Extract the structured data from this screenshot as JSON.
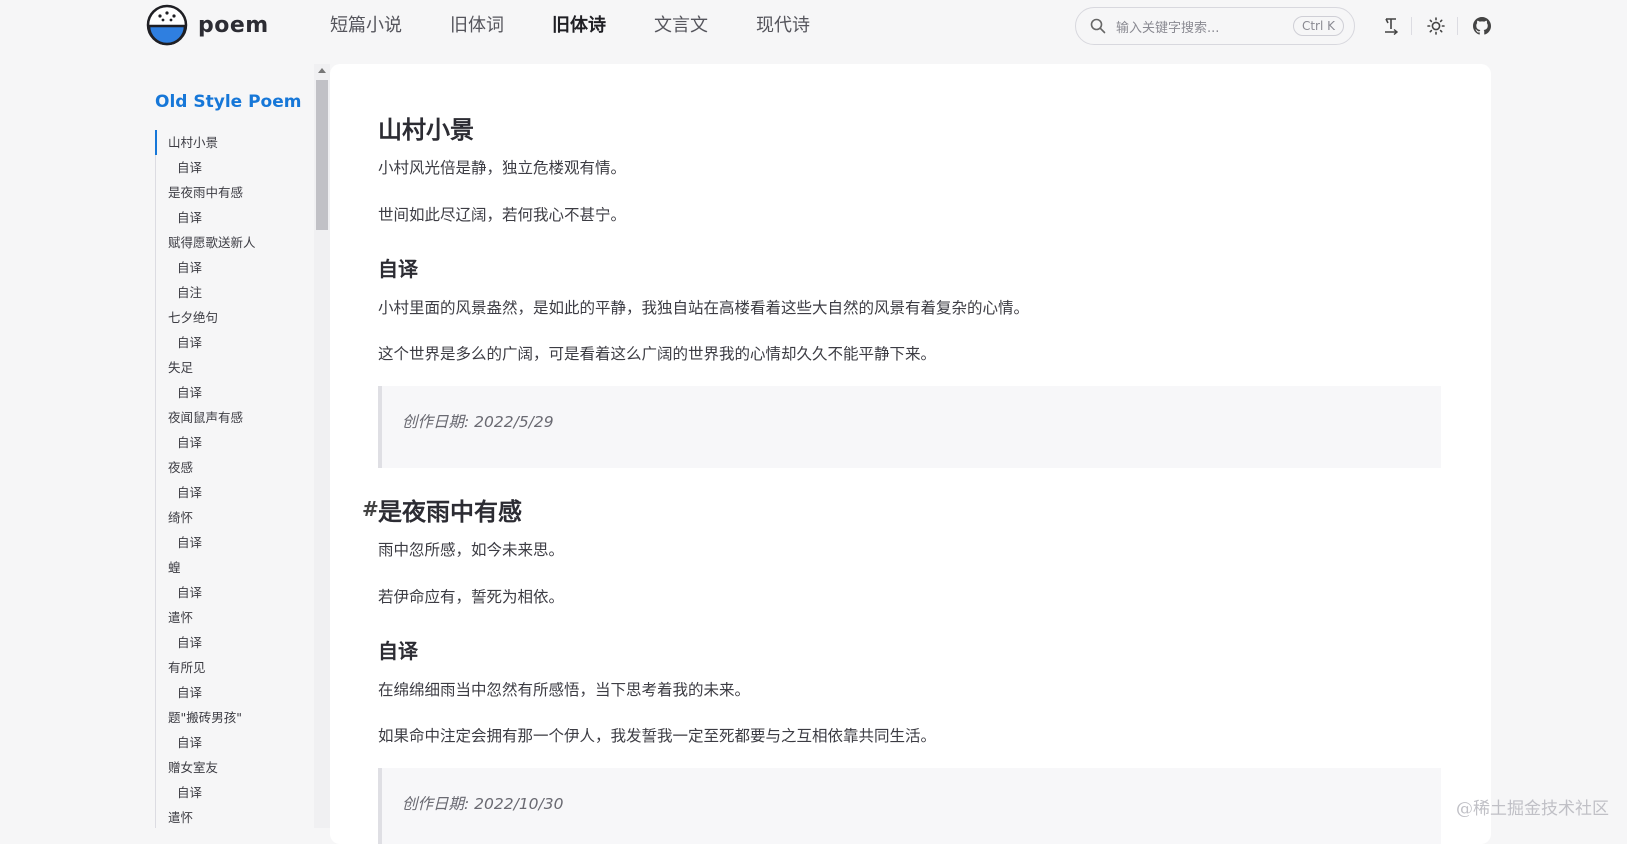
{
  "header": {
    "logo_text": "poem",
    "nav": [
      {
        "label": "短篇小说"
      },
      {
        "label": "旧体词"
      },
      {
        "label": "旧体诗",
        "active": true
      },
      {
        "label": "文言文"
      },
      {
        "label": "现代诗"
      }
    ],
    "search": {
      "placeholder": "输入关键字搜索...",
      "shortcut": "Ctrl K"
    },
    "icons": [
      "text-direction-icon",
      "sun-icon",
      "github-icon"
    ]
  },
  "sidebar": {
    "title": "Old Style Poem",
    "items": [
      {
        "label": "山村小景",
        "level": 1,
        "current": true
      },
      {
        "label": "自译",
        "level": 2
      },
      {
        "label": "是夜雨中有感",
        "level": 1
      },
      {
        "label": "自译",
        "level": 2
      },
      {
        "label": "赋得愿歌送新人",
        "level": 1
      },
      {
        "label": "自译",
        "level": 2
      },
      {
        "label": "自注",
        "level": 2
      },
      {
        "label": "七夕绝句",
        "level": 1
      },
      {
        "label": "自译",
        "level": 2
      },
      {
        "label": "失足",
        "level": 1
      },
      {
        "label": "自译",
        "level": 2
      },
      {
        "label": "夜闻鼠声有感",
        "level": 1
      },
      {
        "label": "自译",
        "level": 2
      },
      {
        "label": "夜感",
        "level": 1
      },
      {
        "label": "自译",
        "level": 2
      },
      {
        "label": "绮怀",
        "level": 1
      },
      {
        "label": "自译",
        "level": 2
      },
      {
        "label": "蝗",
        "level": 1
      },
      {
        "label": "自译",
        "level": 2
      },
      {
        "label": "遣怀",
        "level": 1
      },
      {
        "label": "自译",
        "level": 2
      },
      {
        "label": "有所见",
        "level": 1
      },
      {
        "label": "自译",
        "level": 2
      },
      {
        "label": "题\"搬砖男孩\"",
        "level": 1
      },
      {
        "label": "自译",
        "level": 2
      },
      {
        "label": "赠女室友",
        "level": 1
      },
      {
        "label": "自译",
        "level": 2
      },
      {
        "label": "遣怀",
        "level": 1
      }
    ]
  },
  "article": {
    "sections": [
      {
        "title": "山村小景",
        "lines": [
          "小村风光倍是静，独立危楼观有情。",
          "世间如此尽辽阔，若何我心不甚宁。"
        ],
        "sub_title": "自译",
        "translation": [
          "小村里面的风景盎然，是如此的平静，我独自站在高楼看着这些大自然的风景有着复杂的心情。",
          "这个世界是多么的广阔，可是看着这么广阔的世界我的心情却久久不能平静下来。"
        ],
        "date": "创作日期: 2022/5/29"
      },
      {
        "anchor": "#",
        "title": "是夜雨中有感",
        "lines": [
          "雨中忽所感，如今未来思。",
          "若伊命应有，誓死为相依。"
        ],
        "sub_title": "自译",
        "translation": [
          "在绵绵细雨当中忽然有所感悟，当下思考着我的未来。",
          "如果命中注定会拥有那一个伊人，我发誓我一定至死都要与之互相依靠共同生活。"
        ],
        "date": "创作日期: 2022/10/30"
      }
    ]
  },
  "watermark": "@稀土掘金技术社区",
  "colors": {
    "accent": "#1677d8",
    "background": "#f6f6f7",
    "panel": "#ffffff"
  }
}
